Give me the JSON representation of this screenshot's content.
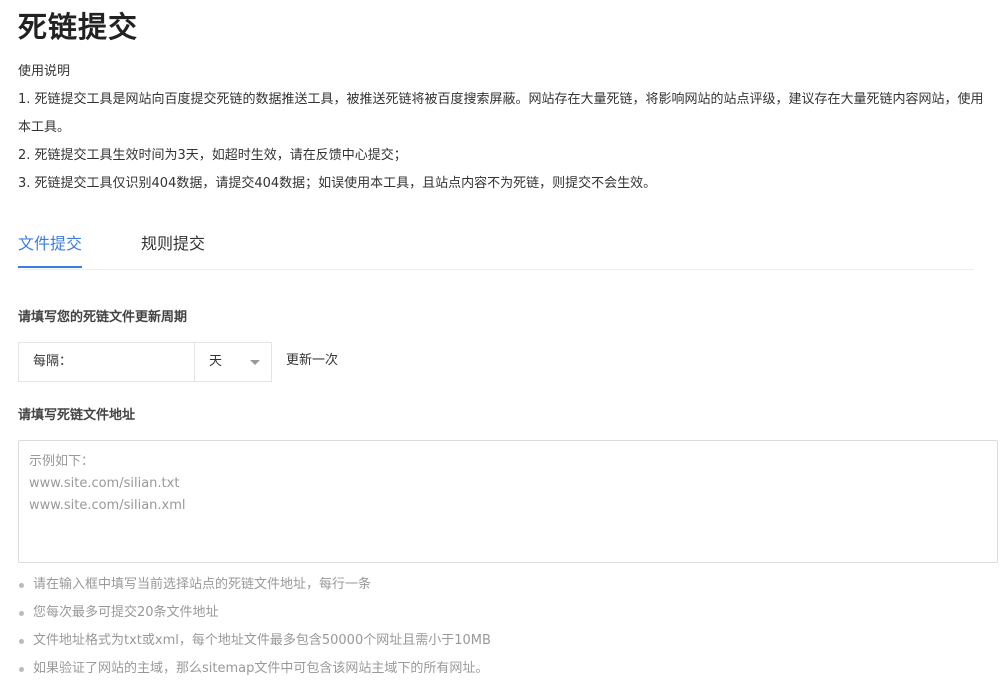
{
  "page": {
    "title": "死链提交"
  },
  "instructions": {
    "heading": "使用说明",
    "items": [
      "1. 死链提交工具是网站向百度提交死链的数据推送工具，被推送死链将被百度搜索屏蔽。网站存在大量死链，将影响网站的站点评级，建议存在大量死链内容网站，使用本工具。",
      "2. 死链提交工具生效时间为3天，如超时生效，请在反馈中心提交；",
      "3. 死链提交工具仅识别404数据，请提交404数据；如误使用本工具，且站点内容不为死链，则提交不会生效。"
    ]
  },
  "tabs": [
    {
      "label": "文件提交",
      "active": true
    },
    {
      "label": "规则提交",
      "active": false
    }
  ],
  "form": {
    "period_label": "请填写您的死链文件更新周期",
    "period_prefix": "每隔：",
    "period_value": "",
    "period_unit": "天",
    "period_suffix": "更新一次",
    "address_label": "请填写死链文件地址",
    "address_placeholder": "示例如下：\nwww.site.com/silian.txt\nwww.site.com/silian.xml",
    "address_value": ""
  },
  "tips": [
    "请在输入框中填写当前选择站点的死链文件地址，每行一条",
    "您每次最多可提交20条文件地址",
    "文件地址格式为txt或xml，每个地址文件最多包含50000个网址且需小于10MB",
    "如果验证了网站的主域，那么sitemap文件中可包含该网站主域下的所有网址。"
  ],
  "colors": {
    "accent": "#3c7ce8",
    "text": "#333333",
    "muted": "#999999",
    "border": "#dcdcdc"
  }
}
